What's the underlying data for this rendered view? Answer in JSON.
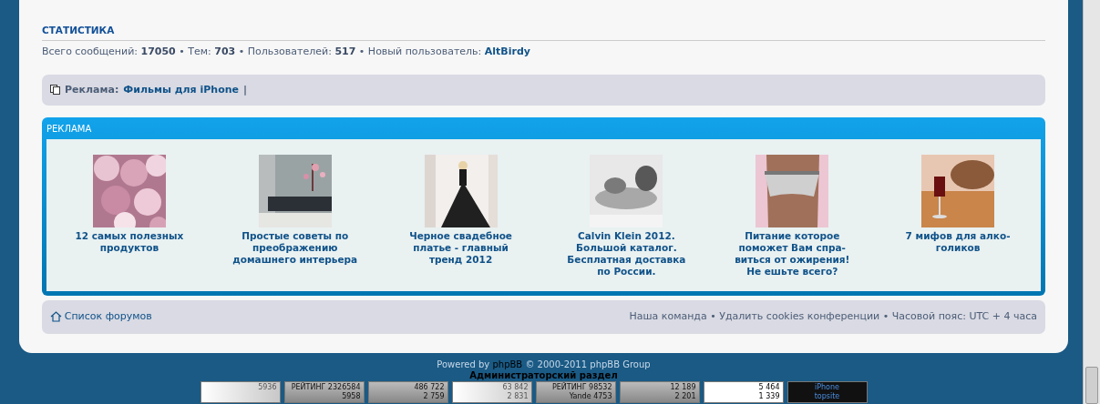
{
  "statistics": {
    "title": "СТАТИСТИКА",
    "separator": "•",
    "items": [
      {
        "label": "Всего сообщений:",
        "value": "17050",
        "kind": "number"
      },
      {
        "label": "Тем:",
        "value": "703",
        "kind": "number"
      },
      {
        "label": "Пользователей:",
        "value": "517",
        "kind": "number"
      },
      {
        "label": "Новый пользователь:",
        "value": "AltBirdy",
        "kind": "link"
      }
    ]
  },
  "sponsor_bar": {
    "label": "Реклама:",
    "link": "Фильмы для iPhone",
    "separator": "|"
  },
  "ads": {
    "title": "РЕКЛАМА",
    "items": [
      {
        "kind": "picture",
        "caption": [
          "12 самых полезных",
          "продуктов"
        ]
      },
      {
        "kind": "picture",
        "caption": [
          "Простые советы по",
          "преображению",
          "домашнего интерьера"
        ]
      },
      {
        "kind": "picture",
        "caption": [
          "Черное свадебное",
          "платье - главный",
          "тренд 2012"
        ]
      },
      {
        "kind": "picture",
        "caption": [
          "Calvin Klein 2012.",
          "Большой каталог.",
          "Бесплатная доставка",
          "по России."
        ]
      },
      {
        "kind": "picture",
        "caption": [
          "Питание которое",
          "поможет Вам спра-",
          "виться от ожирения!",
          "Не ешьте всего?"
        ]
      },
      {
        "kind": "picture",
        "caption": [
          "7 мифов для алко-",
          "голиков"
        ]
      }
    ]
  },
  "footer_nav": {
    "home": "Список форумов",
    "separator": "•",
    "links": [
      "Наша команда",
      "Удалить cookies конференции"
    ],
    "timezone": "Часовой пояс: UTC + 4 часа"
  },
  "footer": {
    "powered_prefix": "Powered by",
    "powered_link": "phpBB",
    "powered_suffix": "© 2000-2011 phpBB Group",
    "admin_link": "Администраторский раздел"
  },
  "counters": [
    {
      "kind": "light",
      "lines": [
        "5936"
      ]
    },
    {
      "kind": "grey",
      "lines": [
        "РЕЙТИНГ 2326584",
        "5958"
      ]
    },
    {
      "kind": "grey",
      "lines": [
        "486 722",
        "2 759"
      ]
    },
    {
      "kind": "light",
      "lines": [
        "63 842",
        "2 831"
      ]
    },
    {
      "kind": "grey",
      "lines": [
        "РЕЙТИНГ 98532",
        "Yande 4753"
      ]
    },
    {
      "kind": "grey",
      "lines": [
        "12 189",
        "2 201"
      ]
    },
    {
      "kind": "white",
      "lines": [
        "5 464",
        "1 339"
      ]
    },
    {
      "kind": "dark",
      "lines": [
        "iPhone",
        "topsite"
      ]
    }
  ]
}
